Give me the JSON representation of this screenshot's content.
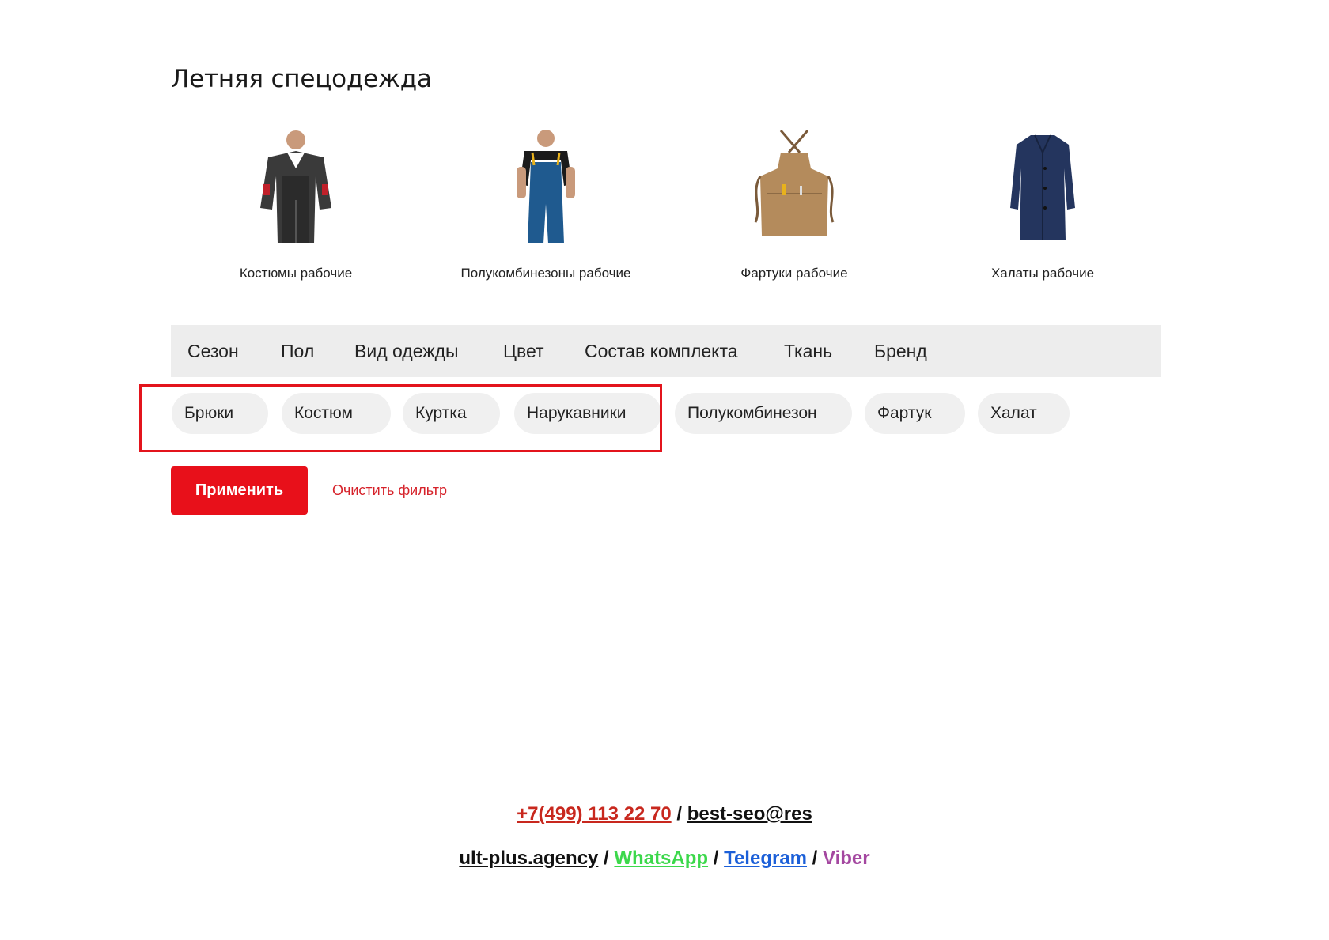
{
  "page": {
    "title": "Летняя спецодежда"
  },
  "categories": [
    {
      "label": "Костюмы рабочие",
      "icon": "work-suit-icon"
    },
    {
      "label": "Полукомбинезоны рабочие",
      "icon": "overalls-icon"
    },
    {
      "label": "Фартуки рабочие",
      "icon": "apron-icon"
    },
    {
      "label": "Халаты рабочие",
      "icon": "robe-icon"
    }
  ],
  "filters": {
    "tabs": [
      "Сезон",
      "Пол",
      "Вид одежды",
      "Цвет",
      "Состав комплекта",
      "Ткань",
      "Бренд"
    ],
    "chips": [
      "Брюки",
      "Костюм",
      "Куртка",
      "Нарукавники",
      "Полукомбинезон",
      "Фартук",
      "Халат"
    ],
    "apply_label": "Применить",
    "clear_label": "Очистить фильтр"
  },
  "footer": {
    "phone": "+7(499) 113 22 70",
    "sep1": " / ",
    "email_part1": "best-seo@res",
    "email_part2": "ult-plus.agency",
    "sep2": " / ",
    "whatsapp": "WhatsApp",
    "sep3": " / ",
    "telegram": "Telegram",
    "sep4": " / ",
    "viber": "Viber"
  },
  "colors": {
    "accent": "#e8101a",
    "highlight_border": "#e3141c",
    "filter_bar_bg": "#ededed",
    "chip_bg": "#f0f0f0"
  }
}
